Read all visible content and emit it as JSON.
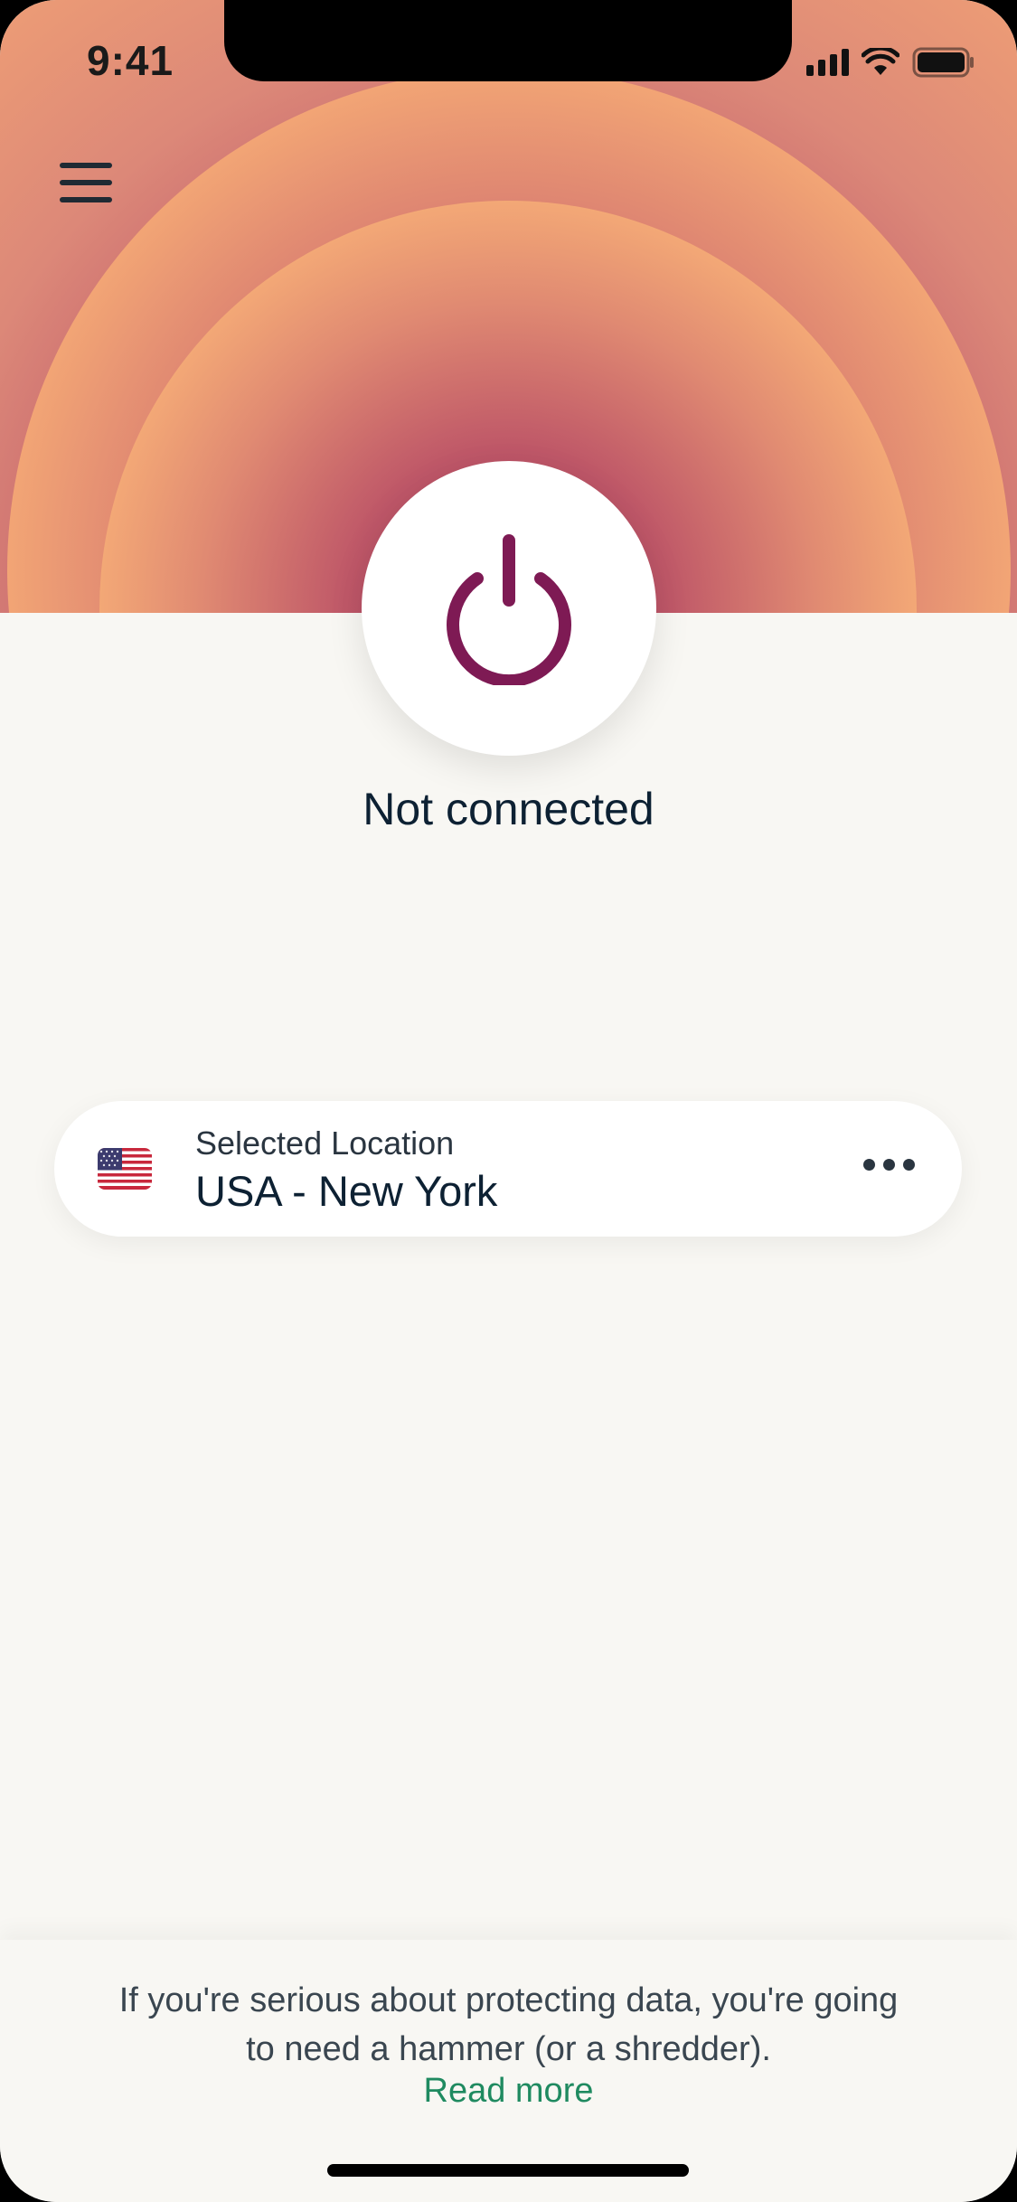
{
  "status_bar": {
    "time": "9:41",
    "icons": [
      "cellular-signal-icon",
      "wifi-icon",
      "battery-icon"
    ]
  },
  "header": {
    "menu_icon": "hamburger-menu-icon"
  },
  "connection": {
    "power_icon": "power-icon",
    "status_text": "Not connected"
  },
  "location": {
    "label": "Selected Location",
    "value": "USA - New York",
    "flag_icon": "us-flag-icon",
    "more_icon": "more-options-icon"
  },
  "tip": {
    "text": "If you're serious about protecting data, you're going to need a hammer (or a shredder).",
    "link_label": "Read more"
  },
  "colors": {
    "accent": "#7e1a54",
    "link": "#1f8a60",
    "text_dark": "#0d2133",
    "background": "#f8f7f3"
  }
}
